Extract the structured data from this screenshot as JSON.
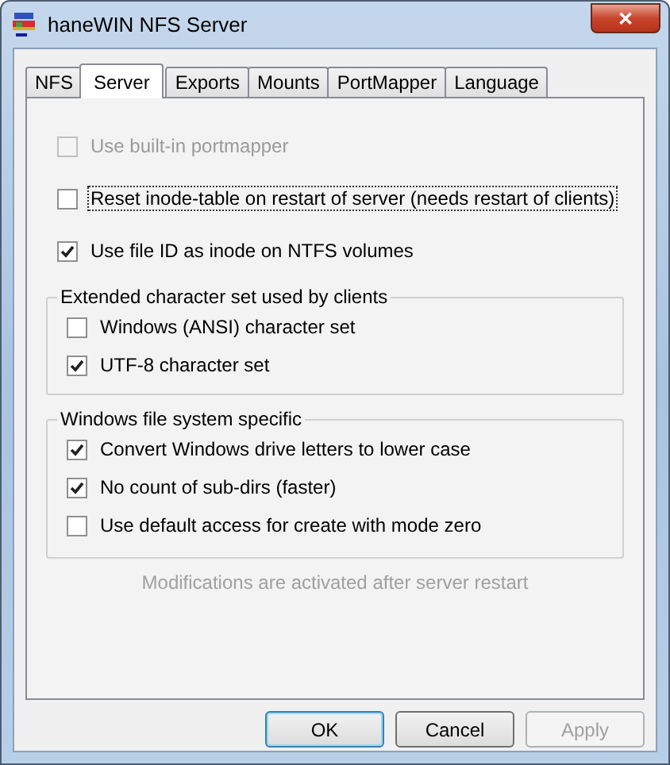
{
  "window": {
    "title": "haneWIN NFS Server",
    "close": "✕"
  },
  "tabs": [
    {
      "label": "NFS",
      "selected": false
    },
    {
      "label": "Server",
      "selected": true
    },
    {
      "label": "Exports",
      "selected": false
    },
    {
      "label": "Mounts",
      "selected": false
    },
    {
      "label": "PortMapper",
      "selected": false
    },
    {
      "label": "Language",
      "selected": false
    }
  ],
  "options": [
    {
      "label": "Use built-in portmapper",
      "checked": false,
      "disabled": true,
      "focused": false
    },
    {
      "label": "Reset inode-table on restart of server (needs restart of clients)",
      "checked": false,
      "disabled": false,
      "focused": true
    },
    {
      "label": "Use file ID as inode on NTFS volumes",
      "checked": true,
      "disabled": false,
      "focused": false
    }
  ],
  "groups": [
    {
      "title": "Extended character set used by clients",
      "options": [
        {
          "label": "Windows (ANSI) character set",
          "checked": false
        },
        {
          "label": "UTF-8 character set",
          "checked": true
        }
      ]
    },
    {
      "title": "Windows file system specific",
      "options": [
        {
          "label": "Convert Windows drive letters to lower case",
          "checked": true
        },
        {
          "label": "No count of sub-dirs (faster)",
          "checked": true
        },
        {
          "label": "Use default access for create with mode zero",
          "checked": false
        }
      ]
    }
  ],
  "note": "Modifications are activated after server restart",
  "buttons": [
    {
      "label": "OK",
      "disabled": false,
      "default": true
    },
    {
      "label": "Cancel",
      "disabled": false,
      "default": false
    },
    {
      "label": "Apply",
      "disabled": true,
      "default": false
    }
  ]
}
